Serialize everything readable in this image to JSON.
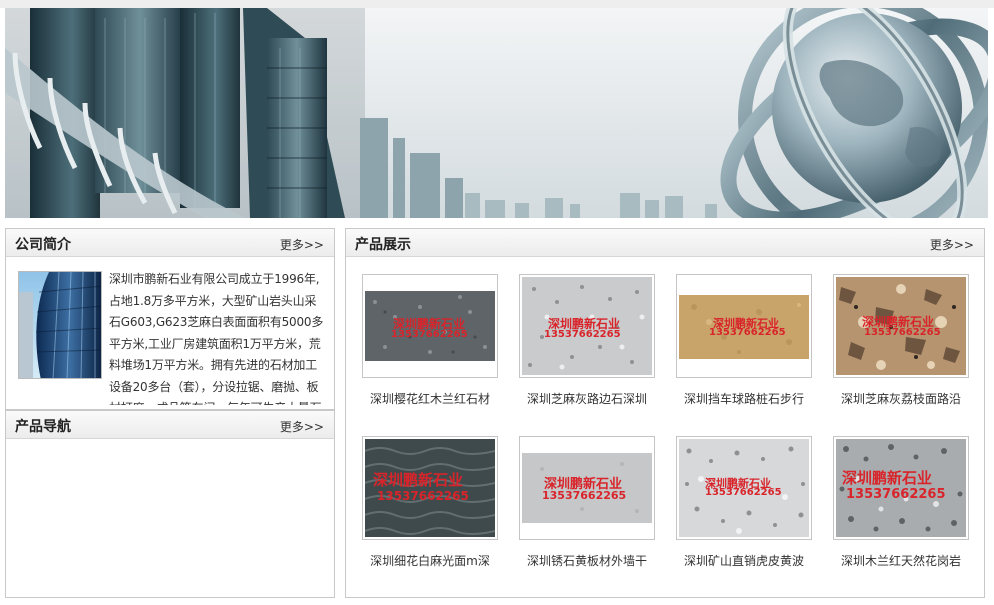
{
  "about": {
    "title": "公司简介",
    "more": "更多>>",
    "text": "深圳市鹏新石业有限公司成立于1996年,占地1.8万多平方米，大型矿山岩头山采石G603,G623芝麻白表面面积有5000多平方米,工业厂房建筑面积1万平方米，荒料堆场1万平方米。拥有先进的石材加工设备20多台（套），分设拉锯、磨抛、板材打磨、成品等车间，每年可生产大量石材"
  },
  "nav": {
    "title": "产品导航",
    "more": "更多>>"
  },
  "products": {
    "title": "产品展示",
    "more": "更多>>",
    "items": [
      {
        "name": "深圳樱花红木兰红石材",
        "watermark": "深圳鹏新石业",
        "phone": "13537662265",
        "stone": "grey-dark"
      },
      {
        "name": "深圳芝麻灰路边石深圳",
        "watermark": "深圳鹏新石业",
        "phone": "13537662265",
        "stone": "grey-light"
      },
      {
        "name": "深圳挡车球路桩石步行",
        "watermark": "深圳鹏新石业",
        "phone": "13537662265",
        "stone": "yellow"
      },
      {
        "name": "深圳芝麻灰荔枝面路沿",
        "watermark": "深圳鹏新石业",
        "phone": "13537662265",
        "stone": "brown-granite"
      },
      {
        "name": "深圳细花白麻光面m深",
        "watermark": "深圳鹏新石业",
        "phone": "13537662265",
        "stone": "dark-water"
      },
      {
        "name": "深圳锈石黄板材外墙干",
        "watermark": "深圳鹏新石业",
        "phone": "13537662265",
        "stone": "flat-grey"
      },
      {
        "name": "深圳矿山直销虎皮黄波",
        "watermark": "深圳鹏新石业",
        "phone": "13537662265",
        "stone": "white-speckle"
      },
      {
        "name": "深圳木兰红天然花岗岩",
        "watermark": "深圳鹏新石业",
        "phone": "13537662265",
        "stone": "grey-speckle"
      }
    ]
  },
  "colors": {
    "watermark": "#d8242a",
    "border": "#c9c9c9"
  }
}
